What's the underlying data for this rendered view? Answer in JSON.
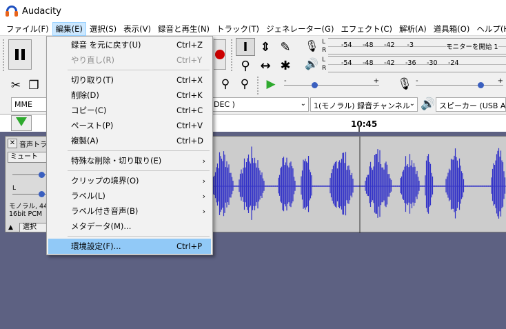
{
  "window": {
    "title": "Audacity"
  },
  "menubar": [
    {
      "label": "ファイル(F)"
    },
    {
      "label": "編集(E)"
    },
    {
      "label": "選択(S)"
    },
    {
      "label": "表示(V)"
    },
    {
      "label": "録音と再生(N)"
    },
    {
      "label": "トラック(T)"
    },
    {
      "label": "ジェネレーター(G)"
    },
    {
      "label": "エフェクト(C)"
    },
    {
      "label": "解析(A)"
    },
    {
      "label": "道具箱(O)"
    },
    {
      "label": "ヘルプ(H)"
    }
  ],
  "edit_menu": [
    {
      "label": "録音 を元に戻す(U)",
      "shortcut": "Ctrl+Z"
    },
    {
      "label": "やり直し(R)",
      "shortcut": "Ctrl+Y",
      "disabled": true
    },
    {
      "label": "切り取り(T)",
      "shortcut": "Ctrl+X"
    },
    {
      "label": "削除(D)",
      "shortcut": "Ctrl+K"
    },
    {
      "label": "コピー(C)",
      "shortcut": "Ctrl+C"
    },
    {
      "label": "ペースト(P)",
      "shortcut": "Ctrl+V"
    },
    {
      "label": "複製(A)",
      "shortcut": "Ctrl+D"
    },
    {
      "label": "特殊な削除・切り取り(E)",
      "submenu": "›"
    },
    {
      "label": "クリップの境界(O)",
      "submenu": "›"
    },
    {
      "label": "ラベル(L)",
      "submenu": "›"
    },
    {
      "label": "ラベル付き音声(B)",
      "submenu": "›"
    },
    {
      "label": "メタデータ(M)..."
    },
    {
      "label": "環境設定(F)...",
      "shortcut": "Ctrl+P",
      "highlighted": true
    }
  ],
  "meters": {
    "record_ticks": [
      "-54",
      "-48",
      "-42",
      "-3"
    ],
    "record_hint": "モニターを開始",
    "record_extra": "1",
    "play_ticks": [
      "-54",
      "-48",
      "-42",
      "-36",
      "-30",
      "-24"
    ],
    "channel_left": "L",
    "channel_right": "R"
  },
  "sliders": {
    "minus": "-",
    "plus": "+"
  },
  "device": {
    "host": "MME",
    "input_suffix": "DEC )",
    "channels": "1(モノラル) 録音チャンネル",
    "output": "スピーカー (USB Audi"
  },
  "timeline": {
    "time_label": "10:45"
  },
  "track": {
    "close": "✕",
    "name": "音声トラ",
    "mute": "ミュート",
    "pan_label": "L",
    "info_line1": "モノラル, 44",
    "info_line2": "16bit PCM",
    "select_label": "選択",
    "collapse": "▲"
  },
  "colors": {
    "waveform": "#3232c8",
    "menu_highlight": "#91c9f7",
    "track_bg": "#5d6182"
  }
}
